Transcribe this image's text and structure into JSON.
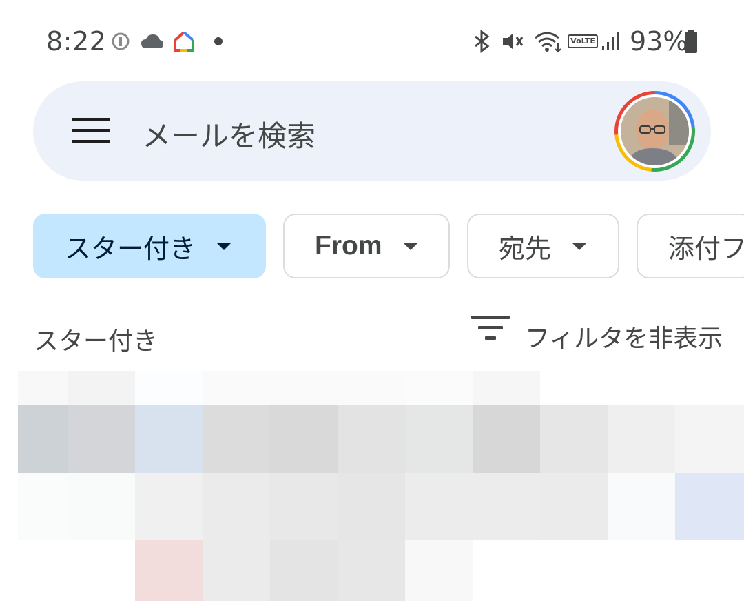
{
  "status_bar": {
    "time": "8:22",
    "battery_percent": "93%",
    "icons": [
      "alert-icon",
      "cloud-icon",
      "google-home-icon",
      "notification-dot-icon",
      "bluetooth-icon",
      "mute-icon",
      "wifi-icon",
      "volte-icon",
      "signal-icon",
      "battery-icon"
    ],
    "volte_label": "VoLTE"
  },
  "search": {
    "placeholder": "メールを検索"
  },
  "filters": {
    "chips": [
      {
        "label": "スター付き",
        "selected": true
      },
      {
        "label": "From",
        "selected": false
      },
      {
        "label": "宛先",
        "selected": false
      },
      {
        "label": "添付フ",
        "selected": false
      }
    ]
  },
  "list_header": {
    "title": "スター付き",
    "filter_toggle_label": "フィルタを非表示"
  },
  "colors": {
    "search_bg": "#edf2fa",
    "selected_chip_bg": "#c2e7ff",
    "text": "#444746"
  }
}
